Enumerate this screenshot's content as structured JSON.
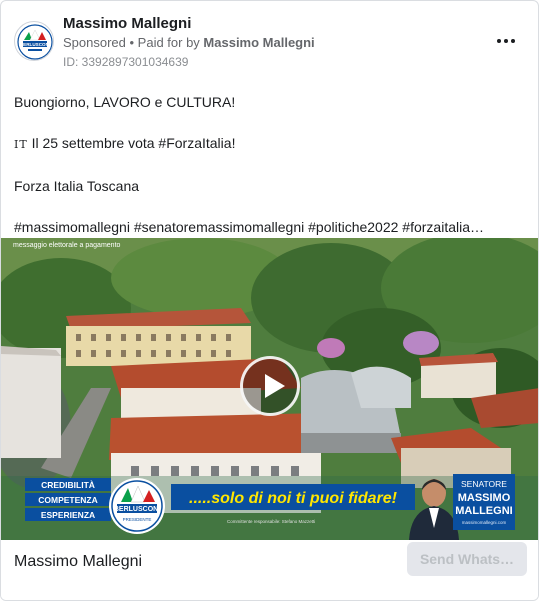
{
  "header": {
    "page_name": "Massimo Mallegni",
    "sponsored_label": "Sponsored",
    "paid_for_prefix": " • Paid for by ",
    "paid_for_by": "Massimo Mallegni",
    "ad_id": "ID: 3392897301034639",
    "avatar_logo_text": "BERLUSCONI",
    "more_icon": "ellipsis-icon"
  },
  "body": {
    "line1": "Buongiorno, LAVORO e CULTURA!",
    "line2_flag": "IT",
    "line2": " Il 25 settembre vota #ForzaItalia!",
    "line3": "Forza Italia Toscana",
    "line4": "#massimomallegni #senatoremassimomallegni #politiche2022 #forzaitalia…"
  },
  "media": {
    "top_left_caption": "messaggio elettorale a pagamento",
    "values": [
      "CREDIBILITÀ",
      "COMPETENZA",
      "ESPERIENZA"
    ],
    "party_logo_text": "BERLUSCONI",
    "party_logo_sub": "PRESIDENTE",
    "slogan": ".....solo di noi ti puoi fidare!",
    "small_caption": "Committente responsabile: Stefano Mazzetti",
    "candidate_title": "SENATORE",
    "candidate_first": "MASSIMO",
    "candidate_last": "MALLEGNI",
    "candidate_web": "massimomallegni.com",
    "play_icon": "play-icon",
    "colors": {
      "brand_blue": "#0a4fa0",
      "slogan_yellow": "#ffe600",
      "roof_red": "#b44c2e"
    }
  },
  "footer": {
    "name": "Massimo Mallegni",
    "cta": "Send Whats…"
  }
}
